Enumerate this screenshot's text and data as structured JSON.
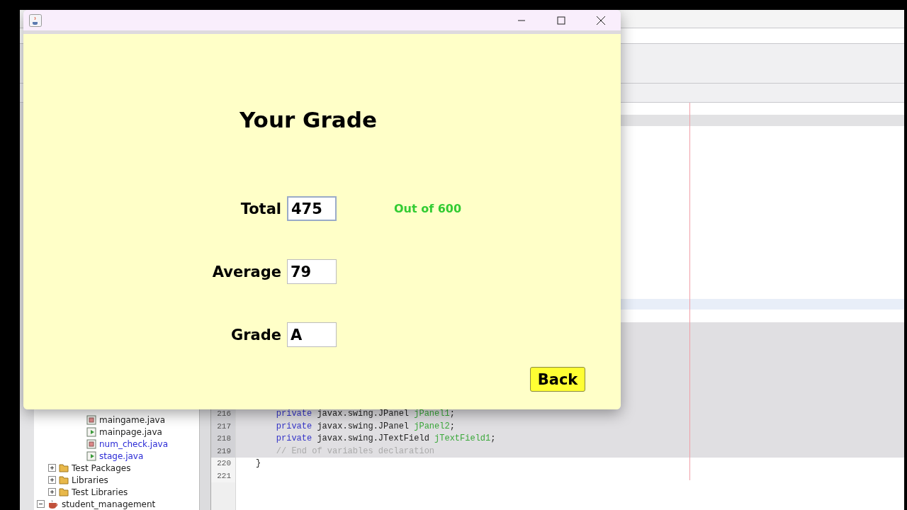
{
  "ide": {
    "package_files": [
      {
        "label": "maingame.java",
        "kind": "form",
        "color": "#222222"
      },
      {
        "label": "mainpage.java",
        "kind": "class",
        "color": "#222222"
      },
      {
        "label": "num_check.java",
        "kind": "form",
        "color": "#2b2bd6"
      },
      {
        "label": "stage.java",
        "kind": "class",
        "color": "#2b2bd6"
      }
    ],
    "project_nodes": [
      {
        "label": "Test Packages",
        "expanded": false
      },
      {
        "label": "Libraries",
        "expanded": false
      },
      {
        "label": "Test Libraries",
        "expanded": false
      }
    ],
    "projects": [
      {
        "label": "student_management",
        "expanded": true
      }
    ],
    "code_lines": [
      {
        "number": "216",
        "guarded": true,
        "tokens": [
          {
            "kind": "keyword",
            "text": "private"
          },
          {
            "kind": "plain",
            "text": " javax.swing.JPanel "
          },
          {
            "kind": "field",
            "text": "jPanel1"
          },
          {
            "kind": "plain",
            "text": ";"
          }
        ]
      },
      {
        "number": "217",
        "guarded": true,
        "tokens": [
          {
            "kind": "keyword",
            "text": "private"
          },
          {
            "kind": "plain",
            "text": " javax.swing.JPanel "
          },
          {
            "kind": "field",
            "text": "jPanel2"
          },
          {
            "kind": "plain",
            "text": ";"
          }
        ]
      },
      {
        "number": "218",
        "guarded": true,
        "tokens": [
          {
            "kind": "keyword",
            "text": "private"
          },
          {
            "kind": "plain",
            "text": " javax.swing.JTextField "
          },
          {
            "kind": "field",
            "text": "jTextField1"
          },
          {
            "kind": "plain",
            "text": ";"
          }
        ]
      },
      {
        "number": "219",
        "guarded": true,
        "tokens": [
          {
            "kind": "comment",
            "text": "// End of variables declaration"
          }
        ]
      },
      {
        "number": "220",
        "guarded": false,
        "tokens": [
          {
            "kind": "brace",
            "text": "}"
          }
        ]
      },
      {
        "number": "221",
        "guarded": false
      }
    ]
  },
  "dialog": {
    "heading": "Your Grade",
    "fields": [
      {
        "label": "Total",
        "value": "475",
        "focused": true,
        "note": "Out of 600"
      },
      {
        "label": "Average",
        "value": "79",
        "focused": false
      },
      {
        "label": "Grade",
        "value": "A",
        "focused": false
      }
    ],
    "back_button": "Back"
  }
}
